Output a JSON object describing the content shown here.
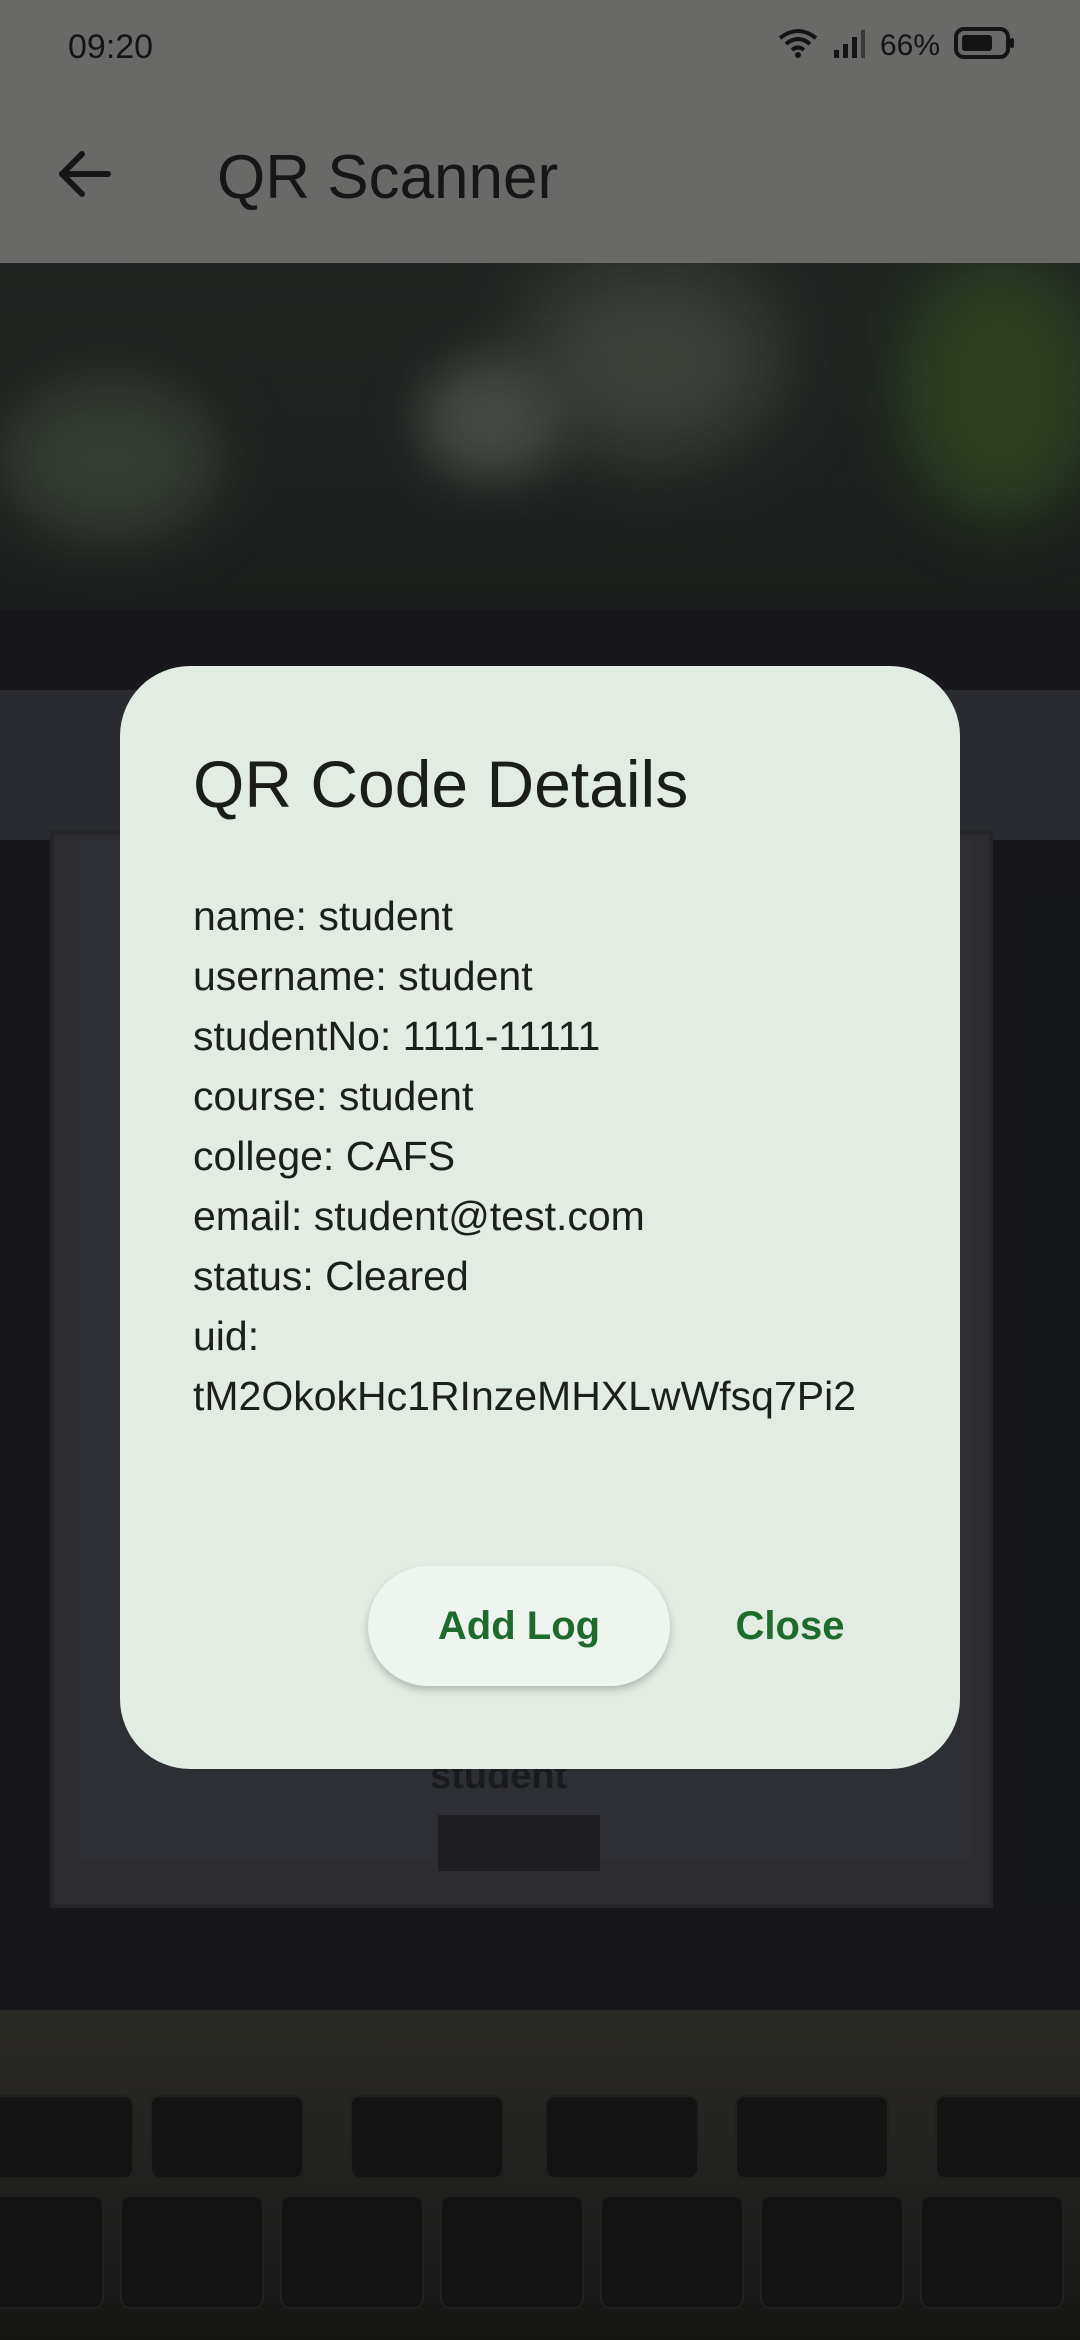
{
  "status_bar": {
    "time": "09:20",
    "battery": "66%",
    "icons": [
      "wifi-icon",
      "signal-icon",
      "battery-icon"
    ]
  },
  "app_bar": {
    "title": "QR Scanner",
    "back_icon": "arrow-left-icon"
  },
  "dialog": {
    "title": "QR Code Details",
    "details": [
      "name: student",
      "username: student",
      "studentNo: 1111-11111",
      "course: student",
      "college: CAFS",
      "email: student@test.com",
      "status: Cleared",
      "uid: tM2OkokHc1RInzeMHXLwWfsq7Pi2"
    ],
    "add_log_label": "Add Log",
    "close_label": "Close"
  },
  "background": {
    "blurred_text": "student"
  },
  "colors": {
    "dialog_bg": "#e2ece2",
    "accent_green": "#1e6b2c",
    "app_bar_bg": "#696a68"
  }
}
